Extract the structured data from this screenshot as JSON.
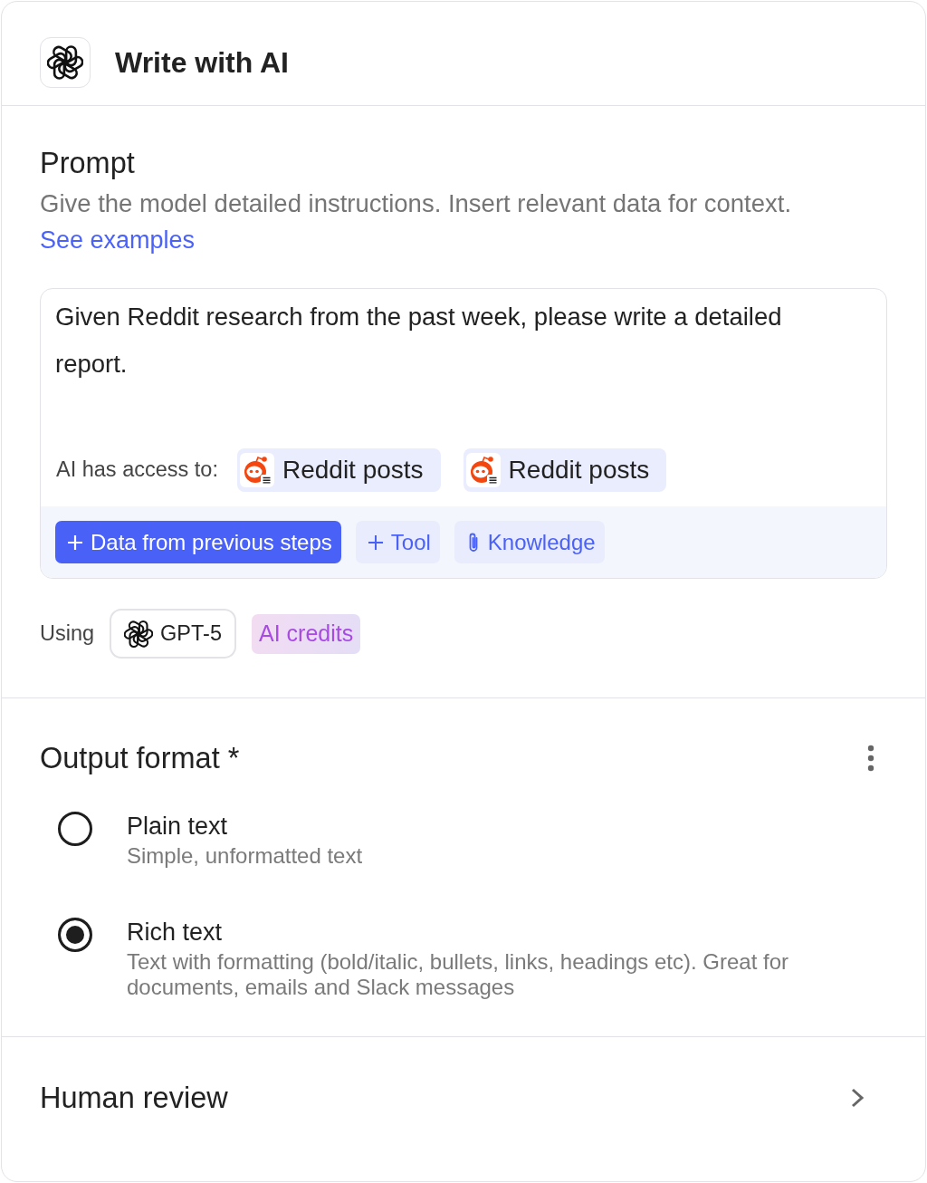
{
  "header": {
    "title": "Write with AI"
  },
  "prompt": {
    "heading": "Prompt",
    "description": "Give the model detailed instructions. Insert relevant data for context.",
    "link": "See examples",
    "editor": {
      "value": "Given Reddit research from the past week, please write a detailed report.",
      "access_label": "AI has access to:",
      "access_items": [
        {
          "label": "Reddit posts"
        },
        {
          "label": "Reddit posts"
        }
      ],
      "actions": [
        {
          "kind": "primary",
          "label": "Data from previous steps"
        },
        {
          "kind": "add",
          "label": "Tool"
        },
        {
          "kind": "attach",
          "label": "Knowledge"
        }
      ]
    }
  },
  "model": {
    "label": "Using",
    "name": "GPT-5",
    "badge": "AI credits"
  },
  "output_format": {
    "heading": "Output format *",
    "options": [
      {
        "title": "Plain text",
        "description": "Simple, unformatted text",
        "selected": false
      },
      {
        "title": "Rich text",
        "description": "Text with formatting (bold/italic, bullets, links, headings etc). Great for documents, emails and Slack messages",
        "selected": true
      }
    ]
  },
  "human_review": {
    "heading": "Human review"
  }
}
